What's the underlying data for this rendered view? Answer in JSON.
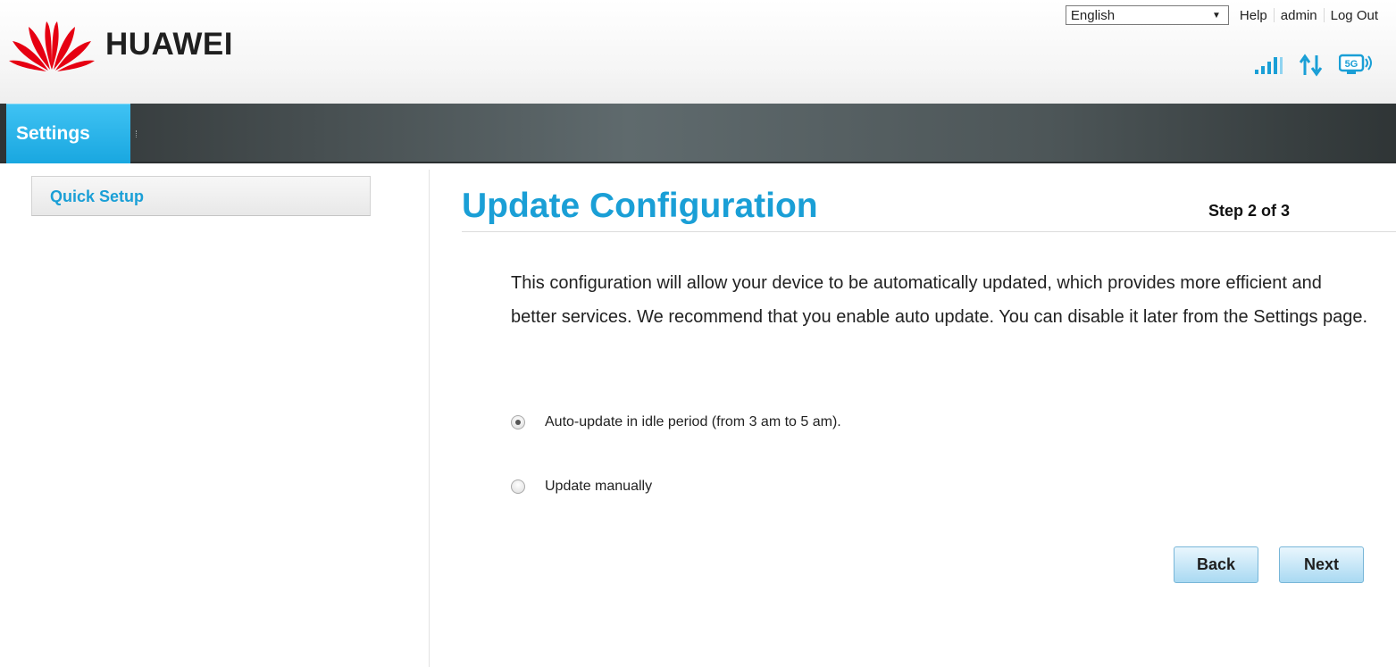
{
  "header": {
    "brand": "HUAWEI",
    "language": {
      "selected": "English"
    },
    "links": {
      "help": "Help",
      "user": "admin",
      "logout": "Log Out"
    },
    "status_icons": [
      "signal-strength-icon",
      "data-transfer-icon",
      "network-5g-icon"
    ],
    "network_badge": "5G"
  },
  "nav": {
    "active_tab": "Settings"
  },
  "sidebar": {
    "items": [
      {
        "label": "Quick Setup"
      }
    ]
  },
  "main": {
    "title": "Update Configuration",
    "step": "Step 2 of 3",
    "description": "This configuration will allow your device to be automatically updated, which provides more efficient and better services. We recommend that you enable auto update. You can disable it later from the Settings page.",
    "options": [
      {
        "label": "Auto-update in idle period (from 3 am to 5 am).",
        "checked": true
      },
      {
        "label": "Update manually",
        "checked": false
      }
    ],
    "buttons": {
      "back": "Back",
      "next": "Next"
    }
  },
  "colors": {
    "accent": "#1a9fd6",
    "brand_red": "#e60012",
    "nav_tab": "#19a7e0"
  }
}
